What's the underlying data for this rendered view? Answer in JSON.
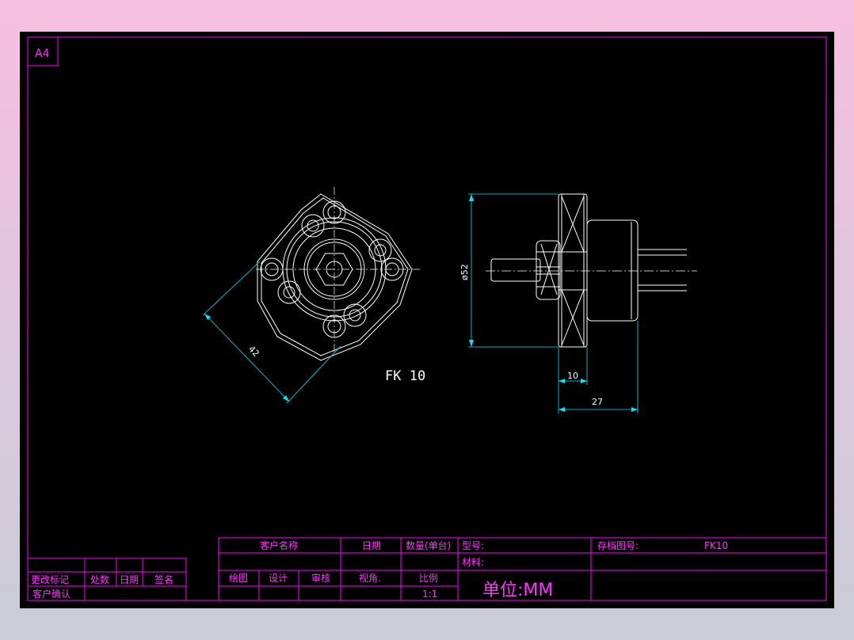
{
  "sheet": {
    "size_label": "A4"
  },
  "drawing": {
    "part_label": "FK 10",
    "dimensions": {
      "diagonal": "42",
      "diameter": "ø52",
      "flange_width": "10",
      "overall_length": "27"
    }
  },
  "title_block": {
    "customer_name": "客户名称",
    "date": "日期",
    "quantity_set": "数量(单台)",
    "model": "型号:",
    "file_no": "存档图号:",
    "file_no_value": "FK10",
    "material": "材料:",
    "drawing_by": "绘图",
    "design": "设计",
    "review": "审核",
    "view_angle": "视角.",
    "scale": "比例",
    "scale_value": "1:1",
    "unit": "单位:MM",
    "revision_mark": "更改标记",
    "location_count": "处数",
    "rev_date": "日期",
    "signature": "签名",
    "customer_confirm": "客户确认"
  },
  "colors": {
    "frame": "#ff00ff",
    "outline": "#ffffff",
    "dimension": "#00e5ff",
    "background": "#000000"
  }
}
